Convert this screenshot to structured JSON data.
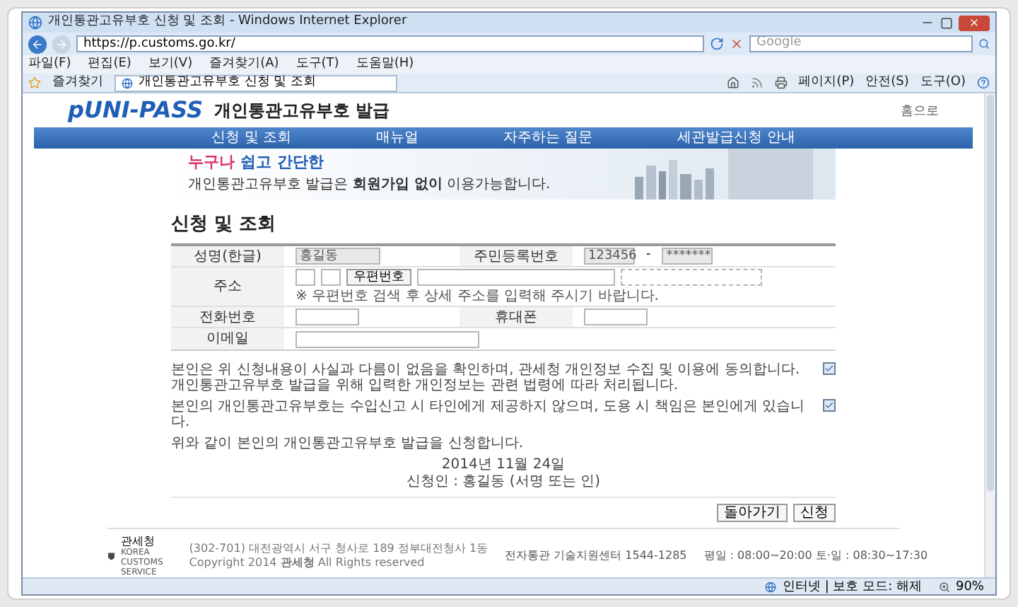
{
  "window": {
    "title": "개인통관고유부호 신청 및 조회 - Windows Internet Explorer"
  },
  "address_bar": {
    "value": "https://p.customs.go.kr/"
  },
  "search": {
    "placeholder": "Google"
  },
  "menu": [
    "파일(F)",
    "편집(E)",
    "보기(V)",
    "즐겨찾기(A)",
    "도구(T)",
    "도움말(H)"
  ],
  "favorites": {
    "label": "즐겨찾기"
  },
  "tab": {
    "label": "개인통관고유부호 신청 및 조회"
  },
  "command_bar": [
    "페이지(P)",
    "안전(S)",
    "도구(O)"
  ],
  "site": {
    "logo": "pUNI-PASS",
    "heading": "개인통관고유부호 발급",
    "home_link": "홈으로"
  },
  "nav": [
    {
      "label": "신청 및 조회"
    },
    {
      "label": "매뉴얼"
    },
    {
      "label": "자주하는 질문"
    },
    {
      "label": "세관발급신청 안내"
    }
  ],
  "banner": {
    "headline_accent": "누구나",
    "headline": "쉽고 간단한",
    "subtitle": "개인통관고유부호 발급은 **회원가입 없이** 이용가능합니다."
  },
  "page_title": "신청 및 조회",
  "form": {
    "name_label": "성명(한글)",
    "name_value": "홍길동",
    "rrn_label": "주민등록번호",
    "rrn_front": "123456",
    "rrn_separator": "-",
    "rrn_back": "*******",
    "address_label": "주소",
    "zip_button": "우편번호",
    "address_note": "※ 우편번호 검색 후 상세 주소를 입력해 주시기 바랍니다.",
    "phone_label": "전화번호",
    "mobile_label": "휴대폰",
    "email_label": "이메일"
  },
  "agreements": [
    {
      "text": "본인은 위 신청내용이 사실과 다름이 없음을 확인하며, 관세청 개인정보 수집 및 이용에 동의합니다. 개인통관고유부호 발급을 위해 입력한 개인정보는 관련 법령에 따라 처리됩니다.",
      "checked": true
    },
    {
      "text": "본인의 개인통관고유부호는 수입신고 시 타인에게 제공하지 않으며, 도용 시 책임은 본인에게 있습니다.",
      "checked": true
    }
  ],
  "declaration": "위와 같이 본인의 개인통관고유부호 발급을 신청합니다.",
  "date": "2014년 11월 24일",
  "applicant": "신청인 : 홍길동 (서명 또는 인)",
  "buttons": [
    "돌아가기",
    "신청"
  ],
  "footer": {
    "org": "관세청",
    "org_en": "KOREA CUSTOMS SERVICE",
    "address": "(302-701) 대전광역시 서구 청사로 189 정부대전청사 1동",
    "copyright": "Copyright 2014 **관세청** All Rights reserved",
    "support": "전자통관 기술지원센터 1544-1285",
    "hours": "평일 : 08:00~20:00   토·일 : 08:30~17:30"
  },
  "status_bar": {
    "zone": "인터넷 | 보호 모드: 해제",
    "zoom": "90%"
  }
}
